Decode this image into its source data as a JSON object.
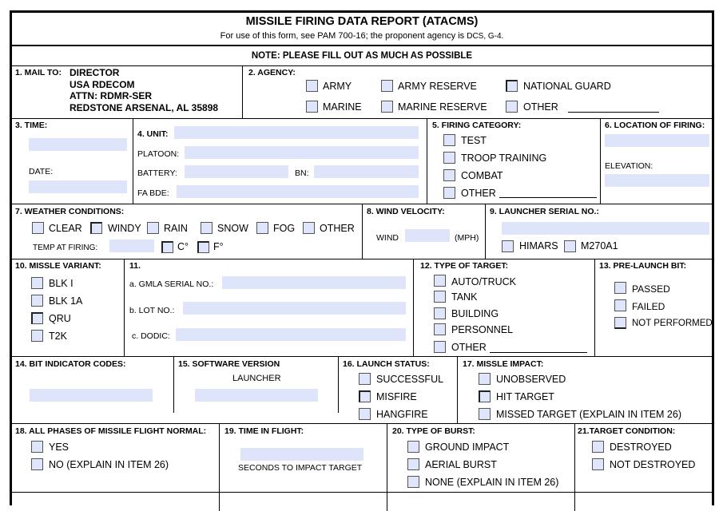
{
  "header": {
    "title": "MISSILE FIRING DATA REPORT (ATACMS)",
    "subtitle_main": "For use of this form, see PAM 700-16; the proponent agency is ",
    "subtitle_agency": "DCS, G-4.",
    "note": "NOTE: PLEASE FILL OUT AS MUCH AS POSSIBLE"
  },
  "mail_to": {
    "label": "1. MAIL TO:",
    "lines": [
      "DIRECTOR",
      "USA RDECOM",
      "ATTN: RDMR-SER",
      "REDSTONE ARSENAL, AL 35898"
    ]
  },
  "agency": {
    "label": "2. AGENCY:",
    "options": [
      "ARMY",
      "ARMY RESERVE",
      "NATIONAL GUARD",
      "MARINE",
      "MARINE RESERVE",
      "OTHER"
    ],
    "other_value": ""
  },
  "time": {
    "label": "3. TIME:",
    "value": "",
    "date_label": "DATE:",
    "date_value": ""
  },
  "unit": {
    "label": "4. UNIT:",
    "value": "",
    "platoon_label": "PLATOON:",
    "platoon_value": "",
    "battery_label": "BATTERY:",
    "battery_value": "",
    "bn_label": "BN:",
    "bn_value": "",
    "fa_bde_label": "FA BDE:",
    "fa_bde_value": ""
  },
  "firing_category": {
    "label": "5. FIRING CATEGORY:",
    "options": [
      "TEST",
      "TROOP TRAINING",
      "COMBAT",
      "OTHER"
    ],
    "other_value": ""
  },
  "location": {
    "label": "6. LOCATION OF FIRING:",
    "value": "",
    "elevation_label": "ELEVATION:",
    "elevation_value": ""
  },
  "weather": {
    "label": "7. WEATHER CONDITIONS:",
    "options": [
      "CLEAR",
      "WINDY",
      "RAIN",
      "SNOW",
      "FOG",
      "OTHER"
    ],
    "temp_label": "TEMP AT FIRING:",
    "temp_value": "",
    "unit_c": "C°",
    "unit_f": "F°"
  },
  "wind": {
    "label": "8. WIND VELOCITY:",
    "wind_label": "WIND",
    "value": "",
    "unit": "(MPH)"
  },
  "launcher": {
    "label": "9. LAUNCHER SERIAL NO.:",
    "value": "",
    "options": [
      "HIMARS",
      "M270A1"
    ]
  },
  "missile_variant": {
    "label": "10. MISSLE VARIANT:",
    "options": [
      "BLK I",
      "BLK 1A",
      "QRU",
      "T2K"
    ]
  },
  "item11": {
    "label": "11.",
    "gmla_label": "a. GMLA SERIAL NO.:",
    "gmla_value": "",
    "lot_label": "b. LOT NO.:",
    "lot_value": "",
    "dodic_label": "c. DODIC:",
    "dodic_value": ""
  },
  "target_type": {
    "label": "12. TYPE OF TARGET:",
    "options": [
      "AUTO/TRUCK",
      "TANK",
      "BUILDING",
      "PERSONNEL",
      "OTHER"
    ],
    "other_value": ""
  },
  "prelaunch_bit": {
    "label": "13. PRE-LAUNCH BIT:",
    "options": [
      "PASSED",
      "FAILED",
      "NOT PERFORMED"
    ]
  },
  "bit_codes": {
    "label": "14. BIT INDICATOR CODES:",
    "value": ""
  },
  "software": {
    "label": "15. SOFTWARE VERSION",
    "sublabel": "LAUNCHER",
    "value": ""
  },
  "launch_status": {
    "label": "16. LAUNCH STATUS:",
    "options": [
      "SUCCESSFUL",
      "MISFIRE",
      "HANGFIRE"
    ]
  },
  "missile_impact": {
    "label": "17. MISSLE IMPACT:",
    "options": [
      "UNOBSERVED",
      "HIT TARGET",
      "MISSED TARGET (EXPLAIN IN ITEM 26)"
    ]
  },
  "flight_normal": {
    "label": "18. ALL PHASES OF MISSILE FLIGHT NORMAL:",
    "options": [
      "YES",
      "NO (EXPLAIN IN ITEM 26)"
    ]
  },
  "time_in_flight": {
    "label": "19. TIME IN FLIGHT:",
    "value": "",
    "caption": "SECONDS TO IMPACT TARGET"
  },
  "burst_type": {
    "label": "20. TYPE OF BURST:",
    "options": [
      "GROUND IMPACT",
      "AERIAL BURST",
      "NONE (EXPLAIN IN ITEM 26)"
    ]
  },
  "target_condition": {
    "label": "21.TARGET CONDITION:",
    "options": [
      "DESTROYED",
      "NOT DESTROYED"
    ]
  }
}
